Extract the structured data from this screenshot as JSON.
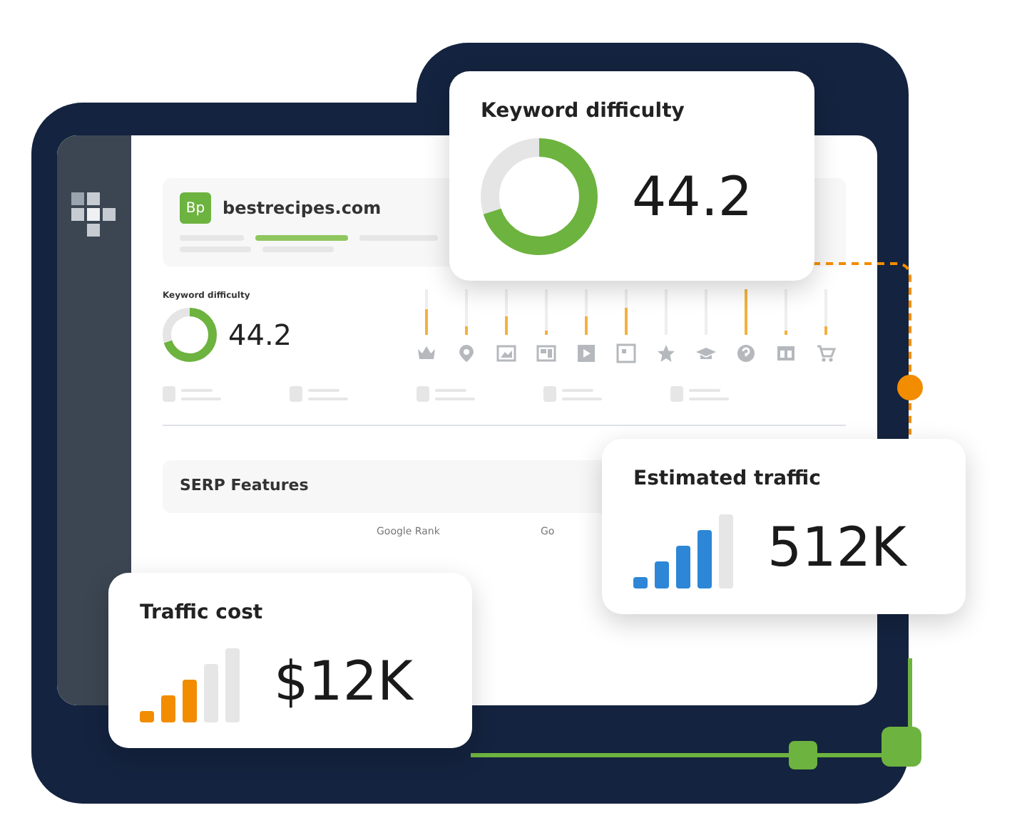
{
  "site": {
    "badge": "Bp",
    "domain": "bestrecipes.com"
  },
  "overview": {
    "label": "Keyword difficulty",
    "value": "44.2"
  },
  "serp_bars": [
    {
      "kind": "filled",
      "level": 0.55
    },
    {
      "kind": "filled",
      "level": 0.2
    },
    {
      "kind": "filled",
      "level": 0.4
    },
    {
      "kind": "filled",
      "level": 0.1
    },
    {
      "kind": "filled",
      "level": 0.4
    },
    {
      "kind": "filled",
      "level": 0.6
    },
    {
      "kind": "empty"
    },
    {
      "kind": "empty"
    },
    {
      "kind": "filled",
      "level": 1
    },
    {
      "kind": "filled",
      "level": 0.1
    },
    {
      "kind": "filled",
      "level": 0.2
    }
  ],
  "section": {
    "title": "SERP Features"
  },
  "table": {
    "columns": [
      "Google Rank",
      "Go"
    ]
  },
  "cards": [
    {
      "kind": "donut",
      "title": "Keyword difficulty",
      "value": "44.2"
    },
    {
      "kind": "signal",
      "title": "Estimated traffic",
      "value": "512K",
      "level": 0.8,
      "color": "#2d86d6"
    },
    {
      "kind": "signal",
      "title": "Traffic cost",
      "value": "$12K",
      "level": 0.6,
      "color": "#f28c00"
    }
  ]
}
